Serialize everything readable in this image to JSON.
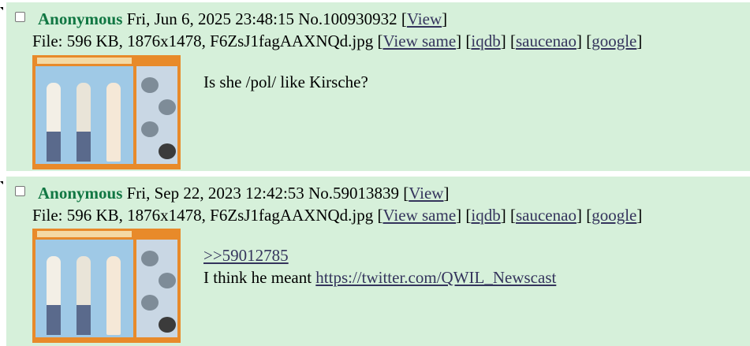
{
  "posts": [
    {
      "name": "Anonymous",
      "datetime": "Fri, Jun 6, 2025 23:48:15",
      "number": "No.100930932",
      "view_link": "View",
      "file_prefix": "File: 596 KB, 1876x1478, F6ZsJ1fagAAXNQd.jpg",
      "file_links": [
        "View same",
        "iqdb",
        "saucenao",
        "google"
      ],
      "message_line1": "Is she /pol/ like Kirsche?",
      "quote_link": "",
      "message_prefix": "",
      "url_link": ""
    },
    {
      "name": "Anonymous",
      "datetime": "Fri, Sep 22, 2023 12:42:53",
      "number": "No.59013839",
      "view_link": "View",
      "file_prefix": "File: 596 KB, 1876x1478, F6ZsJ1fagAAXNQd.jpg",
      "file_links": [
        "View same",
        "iqdb",
        "saucenao",
        "google"
      ],
      "message_line1": "",
      "quote_link": ">>59012785",
      "message_prefix": "I think he meant ",
      "url_link": "https://twitter.com/QWIL_Newscast"
    }
  ],
  "colors": {
    "post_background": "#d6f0da",
    "name": "#117743",
    "link": "#34345c"
  },
  "icons": {
    "side_arrow": "triangle-marker",
    "select_box": "checkbox"
  }
}
